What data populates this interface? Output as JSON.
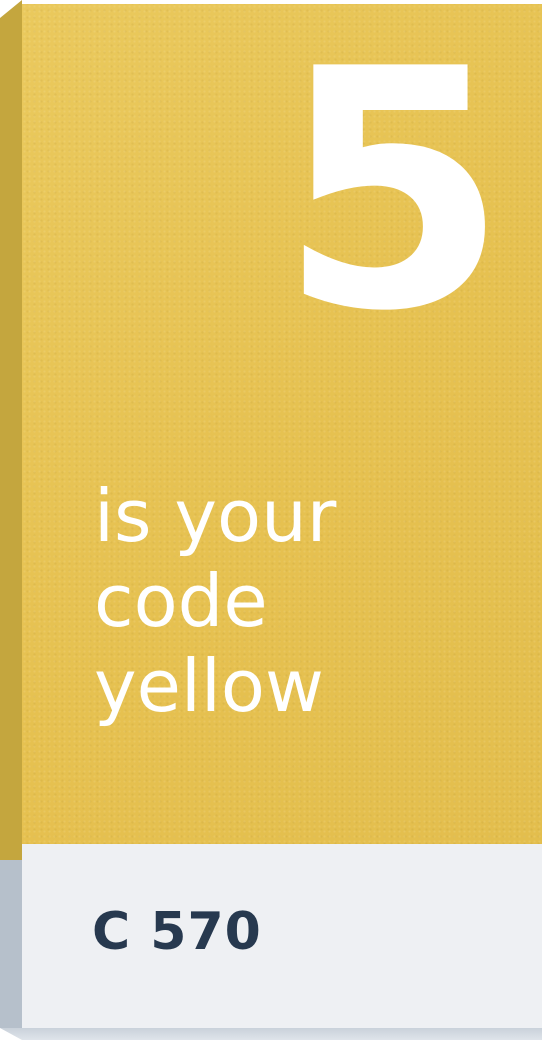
{
  "card": {
    "number": "5",
    "tagline_lines": [
      "is your",
      "code",
      "yellow"
    ],
    "code": "C 570"
  },
  "colors": {
    "face": "#e7c353",
    "edge": "#c4a63e",
    "label_background": "#eef0f3",
    "code_text": "#27394f",
    "face_text": "#ffffff"
  }
}
